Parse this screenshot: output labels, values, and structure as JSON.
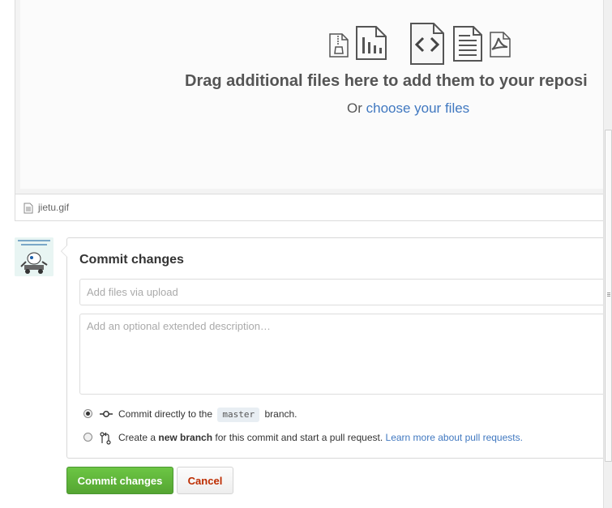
{
  "dropzone": {
    "title": "Drag additional files here to add them to your reposi",
    "subtitle_prefix": "Or ",
    "choose_link": "choose your files",
    "file_type_icons": [
      "zip-file-icon",
      "chart-file-icon",
      "code-file-icon",
      "text-file-icon",
      "pdf-file-icon"
    ]
  },
  "files": [
    {
      "name": "jietu.gif",
      "icon": "file-icon"
    }
  ],
  "commit": {
    "title": "Commit changes",
    "summary_placeholder": "Add files via upload",
    "description_placeholder": "Add an optional extended description…",
    "option_direct_prefix": "Commit directly to the",
    "branch_name": "master",
    "option_direct_suffix": "branch.",
    "option_new_prefix": "Create a",
    "option_new_bold": "new branch",
    "option_new_suffix": "for this commit and start a pull request.",
    "learn_more_link": "Learn more about pull requests.",
    "selected_option": "direct"
  },
  "buttons": {
    "commit_label": "Commit changes",
    "cancel_label": "Cancel"
  },
  "colors": {
    "link": "#4078c0",
    "commit_button": "#6cc644",
    "cancel_text": "#bd2c00"
  }
}
